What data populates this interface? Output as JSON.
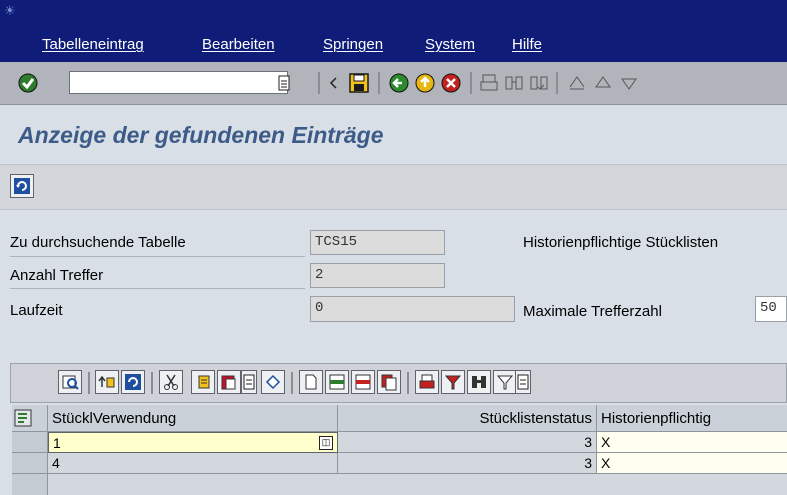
{
  "menu": {
    "items": [
      "Tabelleneintrag",
      "Bearbeiten",
      "Springen",
      "System",
      "Hilfe"
    ]
  },
  "system_toolbar": {
    "command_field_value": "",
    "icons": [
      "enter-icon",
      "back-icon",
      "save-icon",
      "green-back-icon",
      "exit-icon",
      "cancel-icon",
      "print-icon",
      "find-icon",
      "find-next-icon",
      "first-page-icon",
      "prev-page-icon",
      "next-page-icon"
    ]
  },
  "page": {
    "title": "Anzeige der gefundenen Einträge"
  },
  "app_toolbar": {
    "icons": [
      "refresh-icon"
    ]
  },
  "form": {
    "table_label": "Zu durchsuchende Tabelle",
    "table_value": "TCS15",
    "table_desc": "Historienpflichtige Stücklisten",
    "hits_label": "Anzahl Treffer",
    "hits_value": "2",
    "runtime_label": "Laufzeit",
    "runtime_value": "0",
    "max_hits_label": "Maximale Trefferzahl",
    "max_hits_value": "50"
  },
  "alv_toolbar": {
    "icons": [
      "details-icon",
      "sort-ascending-icon",
      "refresh-icon",
      "cut-icon",
      "copy-icon",
      "paste-icon",
      "paste-dropdown-icon",
      "undo-icon",
      "new-row-icon",
      "insert-row-icon",
      "delete-row-icon",
      "copy-row-icon",
      "print-icon",
      "filter-icon",
      "find-icon",
      "set-filter-icon",
      "filter-dropdown-icon"
    ]
  },
  "grid": {
    "columns": [
      "StücklVerwendung",
      "Stücklistenstatus",
      "Historienpflichtig"
    ],
    "rows": [
      {
        "verwendung": "1",
        "status": "3",
        "historie": "X"
      },
      {
        "verwendung": "4",
        "status": "3",
        "historie": "X"
      }
    ]
  },
  "colors": {
    "menubar": "#0f1d78",
    "title": "#3d5b88",
    "selected_cell": "#ffffcc"
  }
}
